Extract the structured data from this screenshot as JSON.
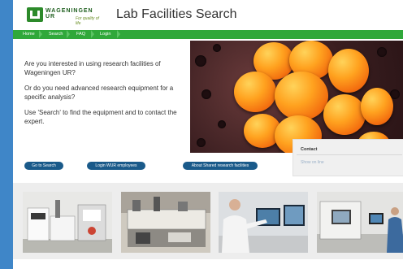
{
  "header": {
    "logo_name": "WAGENINGEN UR",
    "logo_tagline": "For quality of life",
    "title": "Lab Facilities Search"
  },
  "nav": {
    "items": [
      "Home",
      "Search",
      "FAQ",
      "Login"
    ]
  },
  "intro": {
    "p1": "Are you interested in using research facilities of Wageningen UR?",
    "p2": "Or do you need advanced research equipment for a specific analysis?",
    "p3": "Use 'Search' to find the equipment and to contact the expert."
  },
  "contact": {
    "title": "Contact",
    "link": "Show on line"
  },
  "buttons": {
    "go_to_search": "Go to Search",
    "login_wur": "Login WUR employees",
    "shared_facilities": "About Shared research facilities"
  },
  "colors": {
    "nav_green": "#30a83a",
    "button_blue": "#1a5a8a",
    "frame_blue": "#3f86c8"
  }
}
